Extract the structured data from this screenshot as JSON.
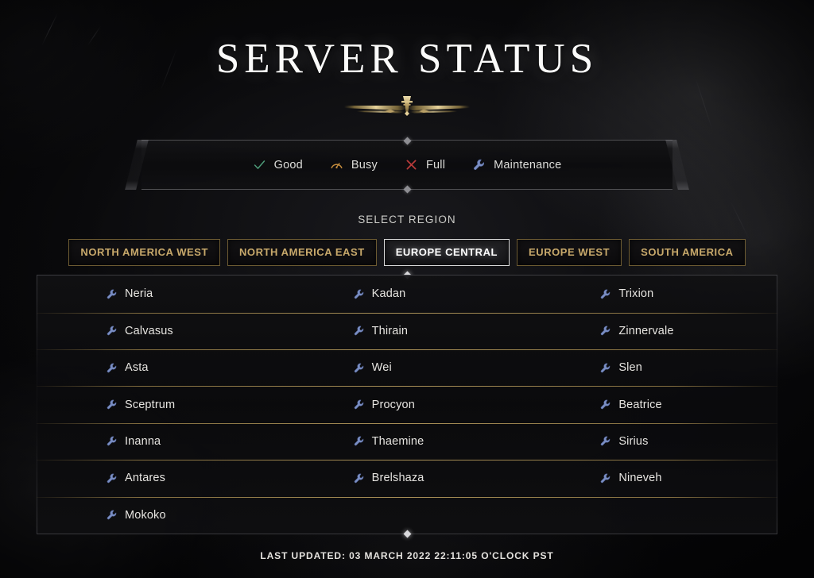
{
  "page": {
    "title": "SERVER STATUS",
    "ornament_name": "lost-ark-emblem"
  },
  "legend": {
    "items": [
      {
        "label": "Good",
        "icon": "check-icon",
        "color": "#4e9e7a"
      },
      {
        "label": "Busy",
        "icon": "gauge-icon",
        "color": "#c98f3e"
      },
      {
        "label": "Full",
        "icon": "x-icon",
        "color": "#b83a3a"
      },
      {
        "label": "Maintenance",
        "icon": "wrench-icon",
        "color": "#7b8fc4"
      }
    ]
  },
  "region": {
    "heading": "SELECT REGION",
    "tabs": [
      {
        "label": "NORTH AMERICA WEST",
        "active": false
      },
      {
        "label": "NORTH AMERICA EAST",
        "active": false
      },
      {
        "label": "EUROPE CENTRAL",
        "active": true
      },
      {
        "label": "EUROPE WEST",
        "active": false
      },
      {
        "label": "SOUTH AMERICA",
        "active": false
      }
    ]
  },
  "servers": {
    "rows": [
      [
        {
          "name": "Neria",
          "status": "Maintenance",
          "icon": "wrench-icon"
        },
        {
          "name": "Kadan",
          "status": "Maintenance",
          "icon": "wrench-icon"
        },
        {
          "name": "Trixion",
          "status": "Maintenance",
          "icon": "wrench-icon"
        }
      ],
      [
        {
          "name": "Calvasus",
          "status": "Maintenance",
          "icon": "wrench-icon"
        },
        {
          "name": "Thirain",
          "status": "Maintenance",
          "icon": "wrench-icon"
        },
        {
          "name": "Zinnervale",
          "status": "Maintenance",
          "icon": "wrench-icon"
        }
      ],
      [
        {
          "name": "Asta",
          "status": "Maintenance",
          "icon": "wrench-icon"
        },
        {
          "name": "Wei",
          "status": "Maintenance",
          "icon": "wrench-icon"
        },
        {
          "name": "Slen",
          "status": "Maintenance",
          "icon": "wrench-icon"
        }
      ],
      [
        {
          "name": "Sceptrum",
          "status": "Maintenance",
          "icon": "wrench-icon"
        },
        {
          "name": "Procyon",
          "status": "Maintenance",
          "icon": "wrench-icon"
        },
        {
          "name": "Beatrice",
          "status": "Maintenance",
          "icon": "wrench-icon"
        }
      ],
      [
        {
          "name": "Inanna",
          "status": "Maintenance",
          "icon": "wrench-icon"
        },
        {
          "name": "Thaemine",
          "status": "Maintenance",
          "icon": "wrench-icon"
        },
        {
          "name": "Sirius",
          "status": "Maintenance",
          "icon": "wrench-icon"
        }
      ],
      [
        {
          "name": "Antares",
          "status": "Maintenance",
          "icon": "wrench-icon"
        },
        {
          "name": "Brelshaza",
          "status": "Maintenance",
          "icon": "wrench-icon"
        },
        {
          "name": "Nineveh",
          "status": "Maintenance",
          "icon": "wrench-icon"
        }
      ],
      [
        {
          "name": "Mokoko",
          "status": "Maintenance",
          "icon": "wrench-icon"
        },
        null,
        null
      ]
    ]
  },
  "footer": {
    "last_updated": "LAST UPDATED: 03 MARCH 2022 22:11:05 O'CLOCK PST"
  },
  "theme": {
    "gold": "#c8a96b",
    "gold_line": "#b09352",
    "accent_white": "#ffffff",
    "background": "#0a0a0b"
  }
}
